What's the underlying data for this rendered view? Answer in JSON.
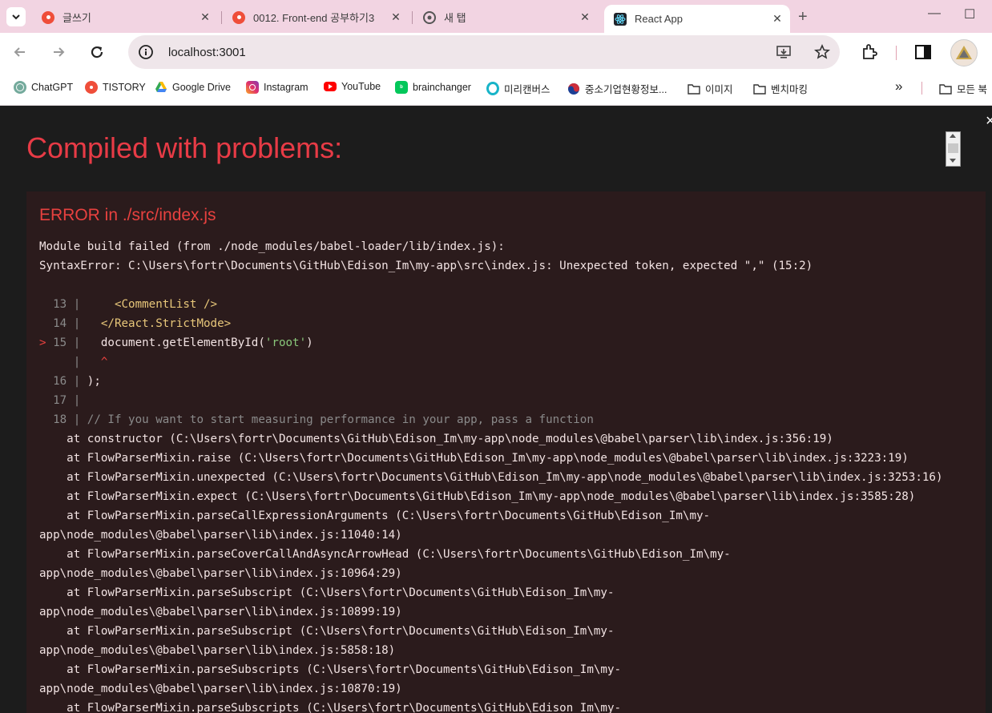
{
  "tabs": [
    {
      "title": "글쓰기",
      "close": "✕"
    },
    {
      "title": "0012. Front-end 공부하기3",
      "close": "✕"
    },
    {
      "title": "새 탭",
      "close": "✕"
    },
    {
      "title": "React App",
      "close": "✕"
    }
  ],
  "new_tab_glyph": "+",
  "window_controls": {
    "minimize": "—",
    "maximize": "☐"
  },
  "address": {
    "url": "localhost:3001"
  },
  "bookmarks": [
    {
      "label": "ChatGPT",
      "icon": "chatgpt-icon"
    },
    {
      "label": "TISTORY",
      "icon": "tistory-icon"
    },
    {
      "label": "Google Drive",
      "icon": "google-drive-icon"
    },
    {
      "label": "Instagram",
      "icon": "instagram-icon"
    },
    {
      "label": "YouTube",
      "icon": "youtube-icon"
    },
    {
      "label": "brainchanger",
      "icon": "blog-icon"
    },
    {
      "label": "미리캔버스",
      "icon": "miricanvas-icon"
    },
    {
      "label": "중소기업현황정보...",
      "icon": "gov-icon"
    },
    {
      "label": "이미지",
      "icon": "folder-icon"
    },
    {
      "label": "벤치마킹",
      "icon": "folder-icon"
    }
  ],
  "bookmarks_overflow": "»",
  "all_bookmarks_label": "모든 북",
  "overlay": {
    "title": "Compiled with problems:",
    "close": "×",
    "error_heading": "ERROR in ./src/index.js",
    "message_lines": [
      "Module build failed (from ./node_modules/babel-loader/lib/index.js):",
      "SyntaxError: C:\\Users\\fortr\\Documents\\GitHub\\Edison_Im\\my-app\\src\\index.js: Unexpected token, expected \",\" (15:2)"
    ],
    "code_lines": [
      {
        "gutter": "  13 | ",
        "parts": [
          {
            "c": "tagc",
            "t": "    <CommentList />"
          }
        ]
      },
      {
        "gutter": "  14 | ",
        "parts": [
          {
            "c": "tagc",
            "t": "  </React.StrictMode>"
          }
        ]
      },
      {
        "gutter": "> 15 | ",
        "parts": [
          {
            "c": "txt",
            "t": "  document.getElementById("
          },
          {
            "c": "str",
            "t": "'root'"
          },
          {
            "c": "txt",
            "t": ")"
          }
        ],
        "marked": true
      },
      {
        "gutter": "     | ",
        "parts": [
          {
            "c": "mark",
            "t": "  ^"
          }
        ]
      },
      {
        "gutter": "  16 | ",
        "parts": [
          {
            "c": "txt",
            "t": ");"
          }
        ]
      },
      {
        "gutter": "  17 | ",
        "parts": []
      },
      {
        "gutter": "  18 | ",
        "parts": [
          {
            "c": "cmt",
            "t": "// If you want to start measuring performance in your app, pass a function"
          }
        ]
      }
    ],
    "stack_lines": [
      "    at constructor (C:\\Users\\fortr\\Documents\\GitHub\\Edison_Im\\my-app\\node_modules\\@babel\\parser\\lib\\index.js:356:19)",
      "    at FlowParserMixin.raise (C:\\Users\\fortr\\Documents\\GitHub\\Edison_Im\\my-app\\node_modules\\@babel\\parser\\lib\\index.js:3223:19)",
      "    at FlowParserMixin.unexpected (C:\\Users\\fortr\\Documents\\GitHub\\Edison_Im\\my-app\\node_modules\\@babel\\parser\\lib\\index.js:3253:16)",
      "    at FlowParserMixin.expect (C:\\Users\\fortr\\Documents\\GitHub\\Edison_Im\\my-app\\node_modules\\@babel\\parser\\lib\\index.js:3585:28)",
      "    at FlowParserMixin.parseCallExpressionArguments (C:\\Users\\fortr\\Documents\\GitHub\\Edison_Im\\my-",
      "app\\node_modules\\@babel\\parser\\lib\\index.js:11040:14)",
      "    at FlowParserMixin.parseCoverCallAndAsyncArrowHead (C:\\Users\\fortr\\Documents\\GitHub\\Edison_Im\\my-",
      "app\\node_modules\\@babel\\parser\\lib\\index.js:10964:29)",
      "    at FlowParserMixin.parseSubscript (C:\\Users\\fortr\\Documents\\GitHub\\Edison_Im\\my-",
      "app\\node_modules\\@babel\\parser\\lib\\index.js:10899:19)",
      "    at FlowParserMixin.parseSubscript (C:\\Users\\fortr\\Documents\\GitHub\\Edison_Im\\my-",
      "app\\node_modules\\@babel\\parser\\lib\\index.js:5858:18)",
      "    at FlowParserMixin.parseSubscripts (C:\\Users\\fortr\\Documents\\GitHub\\Edison_Im\\my-",
      "app\\node_modules\\@babel\\parser\\lib\\index.js:10870:19)",
      "    at FlowParserMixin.parseSubscripts (C:\\Users\\fortr\\Documents\\GitHub\\Edison_Im\\my-"
    ]
  },
  "colors": {
    "accent_error": "#e83b46",
    "tab_strip": "#f2d4e2",
    "error_bg": "#2b1b1c"
  }
}
